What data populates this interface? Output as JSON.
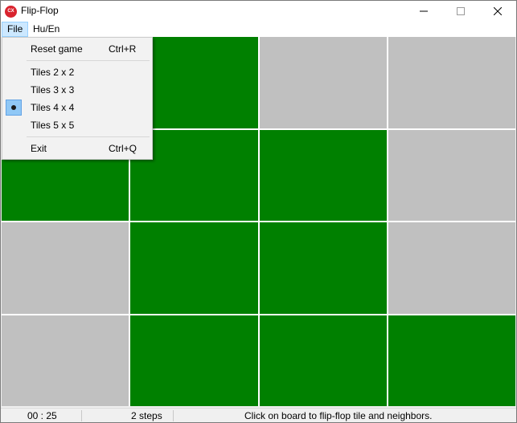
{
  "window": {
    "title": "Flip-Flop",
    "icon_label": "CX",
    "accent_icon_color": "#d9232e"
  },
  "menubar": {
    "items": [
      {
        "label": "File",
        "active": true
      },
      {
        "label": "Hu/En",
        "active": false
      }
    ]
  },
  "file_menu": {
    "reset": {
      "label": "Reset game",
      "shortcut": "Ctrl+R"
    },
    "tiles": [
      {
        "label": "Tiles 2 x 2",
        "selected": false
      },
      {
        "label": "Tiles 3 x 3",
        "selected": false
      },
      {
        "label": "Tiles 4 x 4",
        "selected": true
      },
      {
        "label": "Tiles 5 x 5",
        "selected": false
      }
    ],
    "exit": {
      "label": "Exit",
      "shortcut": "Ctrl+Q"
    }
  },
  "board": {
    "size": 4,
    "on_color": "#008000",
    "off_color": "#c0c0c0",
    "rows": [
      [
        "off",
        "on",
        "off",
        "off"
      ],
      [
        "on",
        "on",
        "on",
        "off"
      ],
      [
        "off",
        "on",
        "on",
        "off"
      ],
      [
        "off",
        "on",
        "on",
        "on"
      ]
    ]
  },
  "status": {
    "time": "00 : 25",
    "steps": "2 steps",
    "hint": "Click on board to flip-flop tile and neighbors."
  }
}
